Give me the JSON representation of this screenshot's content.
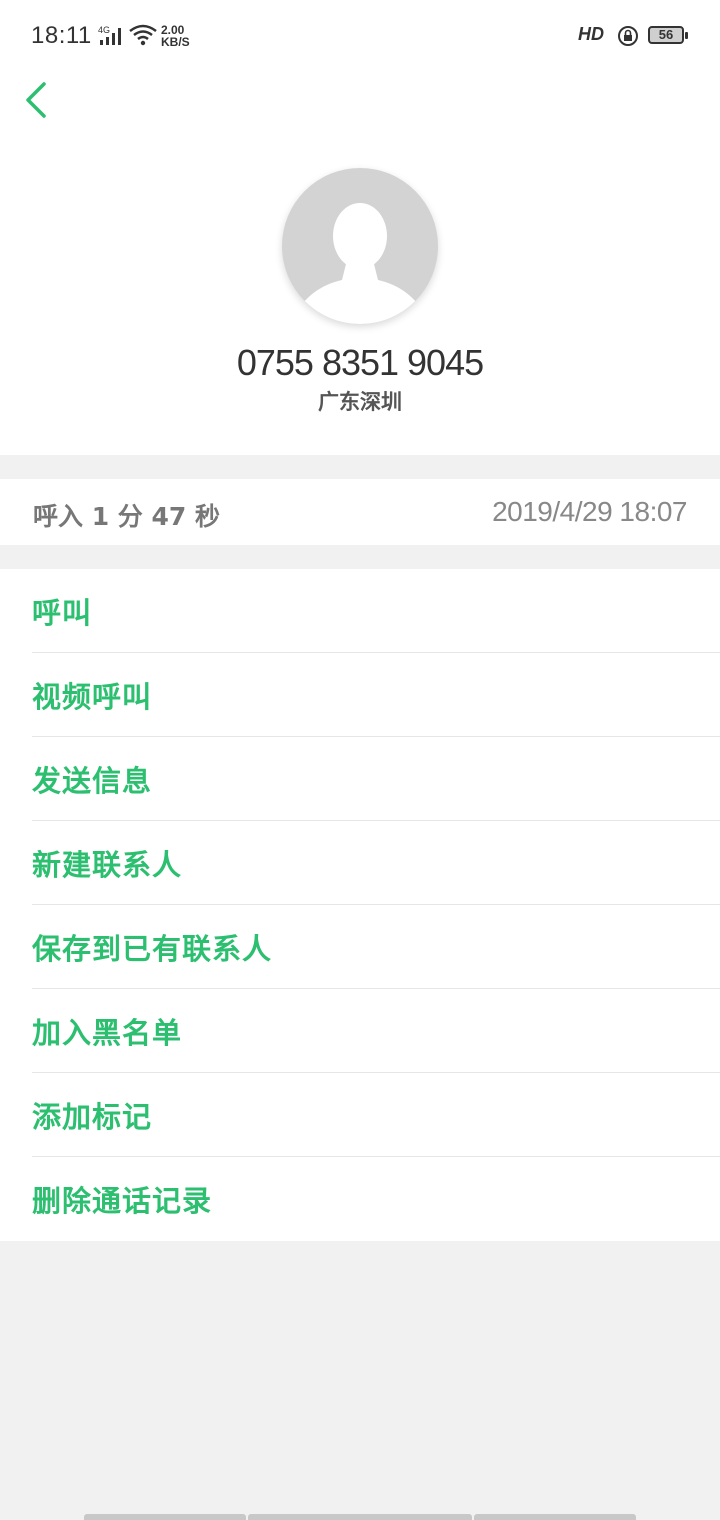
{
  "status_bar": {
    "time": "18:11",
    "network": "4G",
    "speed_value": "2.00",
    "speed_unit": "KB/S",
    "hd_label": "HD",
    "battery": "56"
  },
  "contact": {
    "number": "0755 8351 9045",
    "location": "广东深圳"
  },
  "call": {
    "type_and_duration": "呼入 1 分 47 秒",
    "datetime": "2019/4/29 18:07"
  },
  "actions": [
    {
      "label": "呼叫"
    },
    {
      "label": "视频呼叫"
    },
    {
      "label": "发送信息"
    },
    {
      "label": "新建联系人"
    },
    {
      "label": "保存到已有联系人"
    },
    {
      "label": "加入黑名单"
    },
    {
      "label": "添加标记"
    },
    {
      "label": "删除通话记录"
    }
  ],
  "colors": {
    "accent": "#2cbf70",
    "background": "#f1f1f1",
    "avatar": "#d3d3d3"
  }
}
